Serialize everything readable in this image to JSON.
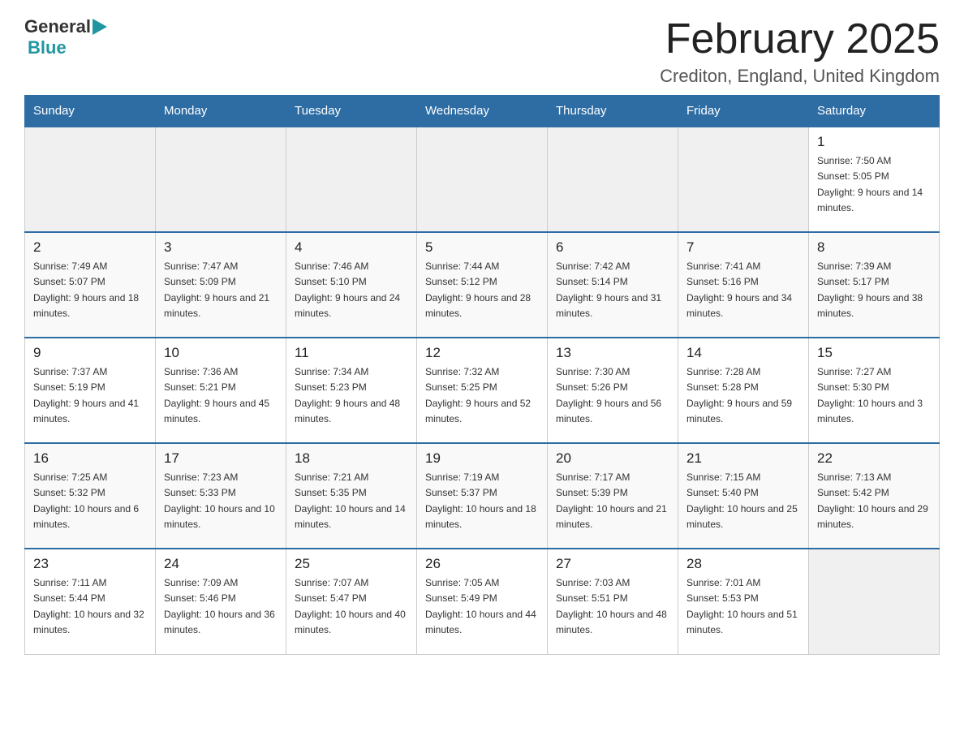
{
  "header": {
    "logo_general": "General",
    "logo_blue": "Blue",
    "title": "February 2025",
    "subtitle": "Crediton, England, United Kingdom"
  },
  "weekdays": [
    "Sunday",
    "Monday",
    "Tuesday",
    "Wednesday",
    "Thursday",
    "Friday",
    "Saturday"
  ],
  "weeks": [
    {
      "days": [
        {
          "number": "",
          "info": ""
        },
        {
          "number": "",
          "info": ""
        },
        {
          "number": "",
          "info": ""
        },
        {
          "number": "",
          "info": ""
        },
        {
          "number": "",
          "info": ""
        },
        {
          "number": "",
          "info": ""
        },
        {
          "number": "1",
          "info": "Sunrise: 7:50 AM\nSunset: 5:05 PM\nDaylight: 9 hours and 14 minutes."
        }
      ]
    },
    {
      "days": [
        {
          "number": "2",
          "info": "Sunrise: 7:49 AM\nSunset: 5:07 PM\nDaylight: 9 hours and 18 minutes."
        },
        {
          "number": "3",
          "info": "Sunrise: 7:47 AM\nSunset: 5:09 PM\nDaylight: 9 hours and 21 minutes."
        },
        {
          "number": "4",
          "info": "Sunrise: 7:46 AM\nSunset: 5:10 PM\nDaylight: 9 hours and 24 minutes."
        },
        {
          "number": "5",
          "info": "Sunrise: 7:44 AM\nSunset: 5:12 PM\nDaylight: 9 hours and 28 minutes."
        },
        {
          "number": "6",
          "info": "Sunrise: 7:42 AM\nSunset: 5:14 PM\nDaylight: 9 hours and 31 minutes."
        },
        {
          "number": "7",
          "info": "Sunrise: 7:41 AM\nSunset: 5:16 PM\nDaylight: 9 hours and 34 minutes."
        },
        {
          "number": "8",
          "info": "Sunrise: 7:39 AM\nSunset: 5:17 PM\nDaylight: 9 hours and 38 minutes."
        }
      ]
    },
    {
      "days": [
        {
          "number": "9",
          "info": "Sunrise: 7:37 AM\nSunset: 5:19 PM\nDaylight: 9 hours and 41 minutes."
        },
        {
          "number": "10",
          "info": "Sunrise: 7:36 AM\nSunset: 5:21 PM\nDaylight: 9 hours and 45 minutes."
        },
        {
          "number": "11",
          "info": "Sunrise: 7:34 AM\nSunset: 5:23 PM\nDaylight: 9 hours and 48 minutes."
        },
        {
          "number": "12",
          "info": "Sunrise: 7:32 AM\nSunset: 5:25 PM\nDaylight: 9 hours and 52 minutes."
        },
        {
          "number": "13",
          "info": "Sunrise: 7:30 AM\nSunset: 5:26 PM\nDaylight: 9 hours and 56 minutes."
        },
        {
          "number": "14",
          "info": "Sunrise: 7:28 AM\nSunset: 5:28 PM\nDaylight: 9 hours and 59 minutes."
        },
        {
          "number": "15",
          "info": "Sunrise: 7:27 AM\nSunset: 5:30 PM\nDaylight: 10 hours and 3 minutes."
        }
      ]
    },
    {
      "days": [
        {
          "number": "16",
          "info": "Sunrise: 7:25 AM\nSunset: 5:32 PM\nDaylight: 10 hours and 6 minutes."
        },
        {
          "number": "17",
          "info": "Sunrise: 7:23 AM\nSunset: 5:33 PM\nDaylight: 10 hours and 10 minutes."
        },
        {
          "number": "18",
          "info": "Sunrise: 7:21 AM\nSunset: 5:35 PM\nDaylight: 10 hours and 14 minutes."
        },
        {
          "number": "19",
          "info": "Sunrise: 7:19 AM\nSunset: 5:37 PM\nDaylight: 10 hours and 18 minutes."
        },
        {
          "number": "20",
          "info": "Sunrise: 7:17 AM\nSunset: 5:39 PM\nDaylight: 10 hours and 21 minutes."
        },
        {
          "number": "21",
          "info": "Sunrise: 7:15 AM\nSunset: 5:40 PM\nDaylight: 10 hours and 25 minutes."
        },
        {
          "number": "22",
          "info": "Sunrise: 7:13 AM\nSunset: 5:42 PM\nDaylight: 10 hours and 29 minutes."
        }
      ]
    },
    {
      "days": [
        {
          "number": "23",
          "info": "Sunrise: 7:11 AM\nSunset: 5:44 PM\nDaylight: 10 hours and 32 minutes."
        },
        {
          "number": "24",
          "info": "Sunrise: 7:09 AM\nSunset: 5:46 PM\nDaylight: 10 hours and 36 minutes."
        },
        {
          "number": "25",
          "info": "Sunrise: 7:07 AM\nSunset: 5:47 PM\nDaylight: 10 hours and 40 minutes."
        },
        {
          "number": "26",
          "info": "Sunrise: 7:05 AM\nSunset: 5:49 PM\nDaylight: 10 hours and 44 minutes."
        },
        {
          "number": "27",
          "info": "Sunrise: 7:03 AM\nSunset: 5:51 PM\nDaylight: 10 hours and 48 minutes."
        },
        {
          "number": "28",
          "info": "Sunrise: 7:01 AM\nSunset: 5:53 PM\nDaylight: 10 hours and 51 minutes."
        },
        {
          "number": "",
          "info": ""
        }
      ]
    }
  ]
}
